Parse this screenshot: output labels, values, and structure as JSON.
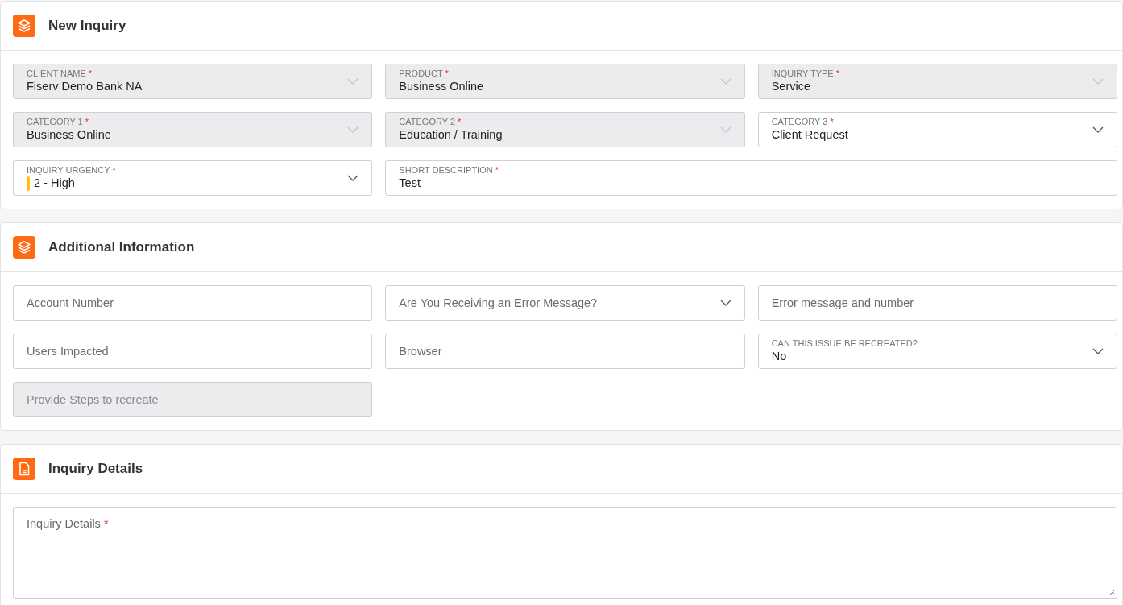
{
  "sections": [
    {
      "title": "New Inquiry",
      "kind": "layers",
      "fields": [
        {
          "kind": "select",
          "label": "CLIENT NAME",
          "required_mark": "*",
          "value": "Fiserv Demo Bank NA",
          "disabled": true
        },
        {
          "kind": "select",
          "label": "PRODUCT",
          "required_mark": "*",
          "value": "Business Online",
          "disabled": true
        },
        {
          "kind": "select",
          "label": "INQUIRY TYPE",
          "required_mark": "*",
          "value": "Service",
          "disabled": true
        },
        {
          "kind": "select",
          "label": "CATEGORY 1",
          "required_mark": "*",
          "value": "Business Online",
          "disabled": true
        },
        {
          "kind": "select",
          "label": "CATEGORY 2",
          "required_mark": "*",
          "value": "Education / Training",
          "disabled": true
        },
        {
          "kind": "select",
          "label": "CATEGORY 3",
          "required_mark": "*",
          "value": "Client Request",
          "disabled": false
        },
        {
          "kind": "select",
          "label": "INQUIRY URGENCY",
          "required_mark": "*",
          "value": "2 - High",
          "color": "#ffc107",
          "disabled": false
        },
        {
          "kind": "text",
          "label": "SHORT DESCRIPTION",
          "required_mark": "*",
          "value": "Test",
          "wide": true,
          "disabled": false
        }
      ]
    },
    {
      "title": "Additional Information",
      "kind": "layers",
      "fields": [
        {
          "kind": "text",
          "placeholder": "Account Number",
          "disabled": false
        },
        {
          "kind": "select",
          "placeholder": "Are You Receiving an Error Message?",
          "disabled": false
        },
        {
          "kind": "text",
          "placeholder": "Error message and number",
          "disabled": false
        },
        {
          "kind": "text",
          "placeholder": "Users Impacted",
          "disabled": false
        },
        {
          "kind": "text",
          "placeholder": "Browser",
          "disabled": false
        },
        {
          "kind": "select",
          "label": "CAN THIS ISSUE BE RECREATED?",
          "value": "No",
          "disabled": false
        },
        {
          "kind": "text",
          "placeholder": "Provide Steps to recreate",
          "disabled": true
        }
      ]
    },
    {
      "title": "Inquiry Details",
      "kind": "document",
      "fields": [
        {
          "kind": "textarea",
          "placeholder": "Inquiry Details",
          "required_mark": "*",
          "disabled": false
        }
      ]
    }
  ]
}
